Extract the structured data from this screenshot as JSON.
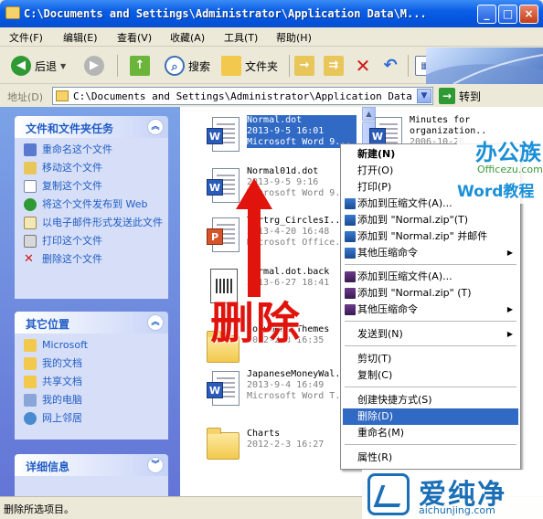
{
  "window": {
    "title": "C:\\Documents and Settings\\Administrator\\Application Data\\M...",
    "min_label": "_",
    "max_label": "□",
    "close_label": "×"
  },
  "menu": [
    "文件(F)",
    "编辑(E)",
    "查看(V)",
    "收藏(A)",
    "工具(T)",
    "帮助(H)"
  ],
  "toolbar": {
    "back_label": "后退",
    "search_label": "搜索",
    "folders_label": "文件夹"
  },
  "address": {
    "label": "地址(D)",
    "value": "C:\\Documents and Settings\\Administrator\\Application Data\\Micros",
    "go_label": "转到"
  },
  "tasks_panel": {
    "title": "文件和文件夹任务",
    "items": [
      "重命名这个文件",
      "移动这个文件",
      "复制这个文件",
      "将这个文件发布到 Web",
      "以电子邮件形式发送此文件",
      "打印这个文件",
      "删除这个文件"
    ]
  },
  "other_places": {
    "title": "其它位置",
    "items": [
      "Microsoft",
      "我的文档",
      "共享文档",
      "我的电脑",
      "网上邻居"
    ]
  },
  "details": {
    "title": "详细信息"
  },
  "files": [
    {
      "name": "Normal.dot",
      "date": "2013-9-5 16:01",
      "type": "Microsoft Word 9..."
    },
    {
      "name": "Minutes for organization...",
      "date": "2006-10-26",
      "type": ""
    },
    {
      "name": "Normal01d.dot",
      "date": "2013-9-5 9:16",
      "type": "Microsoft Word 9..."
    },
    {
      "name": "Tertrg_CirclesI...",
      "date": "2013-4-20 16:48",
      "type": "Microsoft Office..."
    },
    {
      "name": "normal.dot.back",
      "date": "2013-6-27 18:41",
      "type": ""
    },
    {
      "name": "Document Themes",
      "date": "2012-2-3 16:35",
      "type": ""
    },
    {
      "name": "JapaneseMoneyWal...",
      "date": "2013-9-4 16:49",
      "type": "Microsoft Word T..."
    },
    {
      "name": "Charts",
      "date": "2012-2-3 16:27",
      "type": ""
    }
  ],
  "context_menu": {
    "items": [
      "新建(N)",
      "打开(O)",
      "打印(P)",
      "添加到压缩文件(A)...",
      "添加到 \"Normal.zip\"(T)",
      "添加到 \"Normal.zip\" 并邮件",
      "其他压缩命令",
      "添加到压缩文件(A)...",
      "添加到 \"Normal.zip\" (T)",
      "其他压缩命令",
      "发送到(N)",
      "剪切(T)",
      "复制(C)",
      "创建快捷方式(S)",
      "删除(D)",
      "重命名(M)",
      "属性(R)"
    ]
  },
  "annotation": {
    "label": "删除"
  },
  "watermarks": {
    "top_cn": "办公族",
    "top_url": "Officezu.com",
    "top_sub": "Word教程",
    "bottom_cn": "爱纯净",
    "bottom_url": "aichunjing.com"
  },
  "status": {
    "text": "删除所选项目。"
  },
  "colors": {
    "titlebar": "#0a5ee6",
    "selection": "#316ac5",
    "task_link": "#215dc6",
    "annotation_red": "#e0140c"
  }
}
